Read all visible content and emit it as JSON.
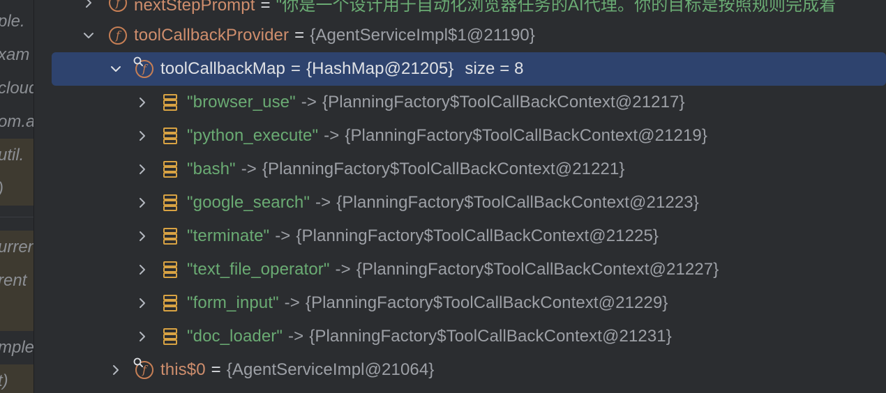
{
  "gutter": {
    "items": [
      {
        "text": "ple.",
        "highlight": false
      },
      {
        "text": "xam",
        "highlight": false
      },
      {
        "text": "cloud",
        "highlight": false
      },
      {
        "text": "om.a",
        "highlight": false
      },
      {
        "text": "util.",
        "highlight": true
      },
      {
        "text": ")",
        "highlight": true
      },
      {
        "text": "urren",
        "highlight": true
      },
      {
        "text": "rent",
        "highlight": true
      },
      {
        "text": "",
        "highlight": true
      },
      {
        "text": "mple",
        "highlight": false
      },
      {
        "text": "t)",
        "highlight": true
      }
    ]
  },
  "tree": {
    "next_step": {
      "name": "nextStepPrompt",
      "value": "\"你是一个设计用于自动化浏览器任务的AI代理。你的目标是按照规则完成着"
    },
    "provider": {
      "name": "toolCallbackProvider",
      "value": "{AgentServiceImpl$1@21190}"
    },
    "map": {
      "name": "toolCallbackMap",
      "value": "{HashMap@21205}",
      "size_label": "size = 8"
    },
    "entries": [
      {
        "key": "\"browser_use\"",
        "value": "{PlanningFactory$ToolCallBackContext@21217}"
      },
      {
        "key": "\"python_execute\"",
        "value": "{PlanningFactory$ToolCallBackContext@21219}"
      },
      {
        "key": "\"bash\"",
        "value": "{PlanningFactory$ToolCallBackContext@21221}"
      },
      {
        "key": "\"google_search\"",
        "value": "{PlanningFactory$ToolCallBackContext@21223}"
      },
      {
        "key": "\"terminate\"",
        "value": "{PlanningFactory$ToolCallBackContext@21225}"
      },
      {
        "key": "\"text_file_operator\"",
        "value": "{PlanningFactory$ToolCallBackContext@21227}"
      },
      {
        "key": "\"form_input\"",
        "value": "{PlanningFactory$ToolCallBackContext@21229}"
      },
      {
        "key": "\"doc_loader\"",
        "value": "{PlanningFactory$ToolCallBackContext@21231}"
      }
    ],
    "this0": {
      "name": "this$0",
      "value": "{AgentServiceImpl@21064}"
    },
    "field_icon_glyph": "f",
    "eq": "=",
    "arrow": "->"
  },
  "colors": {
    "background": "#2b2d30",
    "selection": "#2e436e",
    "string": "#6aab73",
    "field_orange": "#cf8e6d",
    "grey_value": "#9da0a6",
    "map_icon": "#d9a343"
  }
}
